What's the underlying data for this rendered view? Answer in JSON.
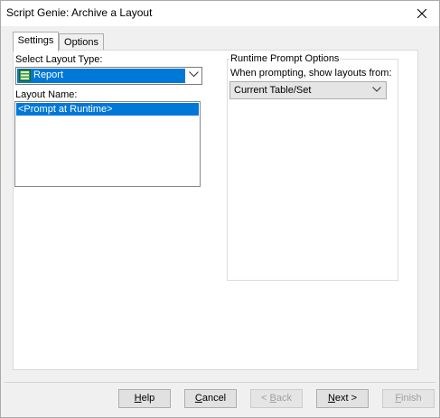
{
  "window": {
    "title": "Script Genie:  Archive a Layout"
  },
  "tabs": [
    {
      "label": "Settings",
      "active": true
    },
    {
      "label": "Options",
      "active": false
    }
  ],
  "settings": {
    "layout_type_label": "Select Layout Type:",
    "layout_type_value": "Report",
    "layout_type_icon": "report-icon",
    "layout_name_label": "Layout Name:",
    "layout_names": [
      "<Prompt at Runtime>"
    ]
  },
  "runtime": {
    "group_title": "Runtime Prompt Options",
    "prompt_label": "When prompting, show layouts from:",
    "prompt_value": "Current Table/Set"
  },
  "buttons": {
    "help": {
      "pre": "",
      "key": "H",
      "post": "elp"
    },
    "cancel": {
      "pre": "",
      "key": "C",
      "post": "ancel"
    },
    "back": {
      "pre": "< ",
      "key": "B",
      "post": "ack"
    },
    "next": {
      "pre": "",
      "key": "N",
      "post": "ext >"
    },
    "finish": {
      "pre": "",
      "key": "F",
      "post": "inish"
    }
  },
  "colors": {
    "selection": "#0078d7",
    "disabled_text": "#a0a0a0"
  }
}
